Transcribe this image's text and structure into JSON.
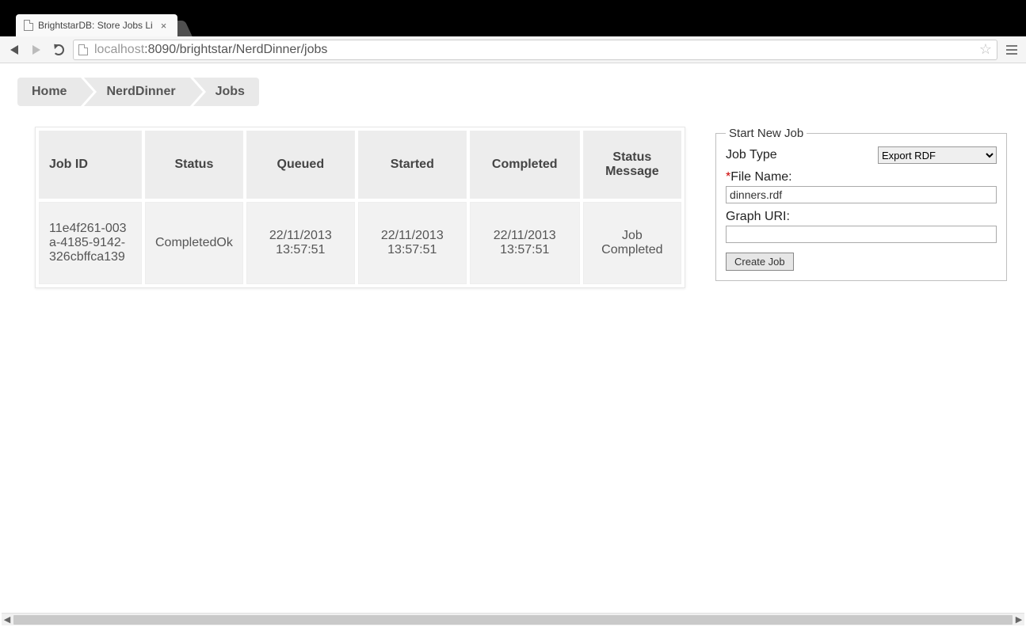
{
  "browser": {
    "tab_title": "BrightstarDB: Store Jobs Li",
    "url_display": "localhost:8090/brightstar/NerdDinner/jobs",
    "url_host_prefix": "localhost",
    "url_rest": ":8090/brightstar/NerdDinner/jobs"
  },
  "breadcrumb": [
    "Home",
    "NerdDinner",
    "Jobs"
  ],
  "table": {
    "headers": [
      "Job ID",
      "Status",
      "Queued",
      "Started",
      "Completed",
      "Status Message"
    ],
    "rows": [
      {
        "job_id": "11e4f261-003a-4185-9142-326cbffca139",
        "status": "CompletedOk",
        "queued": "22/11/2013 13:57:51",
        "started": "22/11/2013 13:57:51",
        "completed": "22/11/2013 13:57:51",
        "message": "Job Completed"
      }
    ]
  },
  "form": {
    "legend": "Start New Job",
    "job_type_label": "Job Type",
    "job_type_selected": "Export RDF",
    "file_name_label": "File Name:",
    "file_name_value": "dinners.rdf",
    "graph_uri_label": "Graph URI:",
    "graph_uri_value": "",
    "submit_label": "Create Job"
  }
}
